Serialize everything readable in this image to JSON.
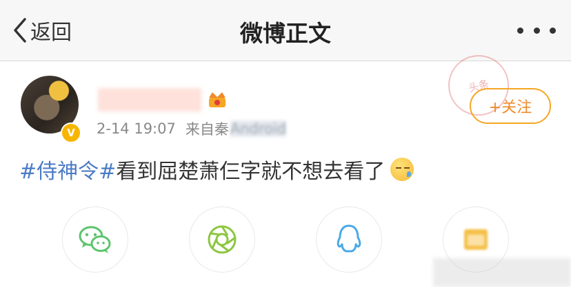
{
  "navbar": {
    "back_label": "返回",
    "title": "微博正文"
  },
  "post": {
    "username": "",
    "timestamp": "2-14 19:07",
    "source_label": "来自秦",
    "source_blurred": "Android",
    "follow_label": "+关注",
    "hashtag": "#侍神令#",
    "body": "看到屈楚萧仨字就不想去看了"
  },
  "stamp_text": "头条",
  "share": {
    "items": [
      "wechat-icon",
      "moments-icon",
      "qq-icon",
      "qzone-icon"
    ]
  },
  "colors": {
    "accent_orange": "#f5a623",
    "hashtag_blue": "#4a7bc5",
    "wechat_green": "#5cc46b",
    "moments_green": "#8cc63f",
    "qq_blue": "#4aa8e8",
    "qzone_yellow": "#f5c04a"
  }
}
